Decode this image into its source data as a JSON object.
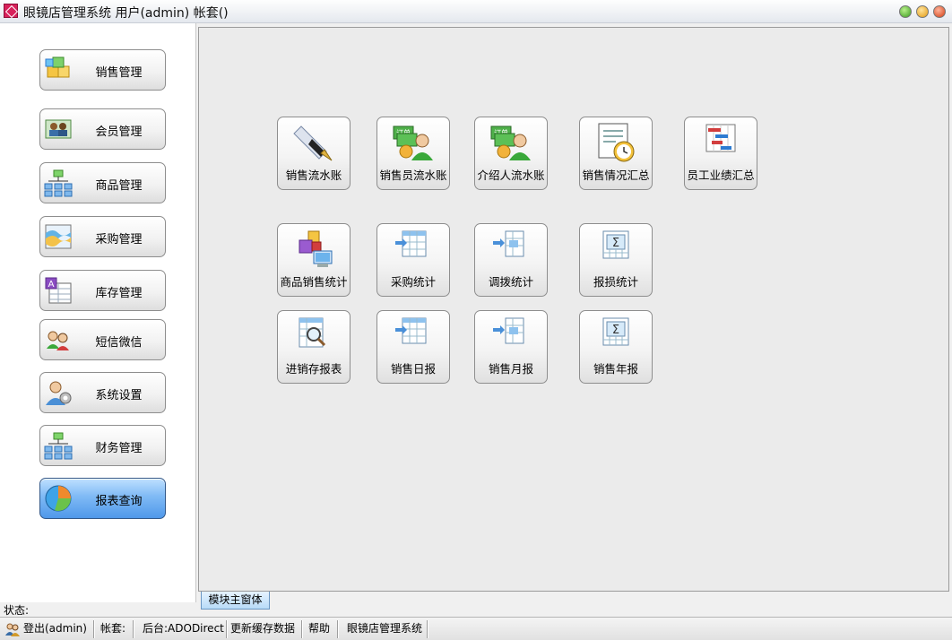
{
  "window": {
    "title": "眼镜店管理系统 用户(admin) 帐套()"
  },
  "sidebar": {
    "items": [
      {
        "label": "销售管理",
        "icon": "cubes-icon"
      },
      {
        "label": "会员管理",
        "icon": "members-icon"
      },
      {
        "label": "商品管理",
        "icon": "hierarchy-icon"
      },
      {
        "label": "采购管理",
        "icon": "wave-chart-icon"
      },
      {
        "label": "库存管理",
        "icon": "inventory-icon"
      },
      {
        "label": "短信微信",
        "icon": "people-chat-icon"
      },
      {
        "label": "系统设置",
        "icon": "user-gear-icon"
      },
      {
        "label": "财务管理",
        "icon": "hierarchy-icon"
      },
      {
        "label": "报表查询",
        "icon": "pie-chart-icon",
        "active": true
      }
    ]
  },
  "main": {
    "tiles": [
      {
        "label": "销售流水账",
        "icon": "fountain-pen-icon"
      },
      {
        "label": "销售员流水账",
        "icon": "order-user-icon"
      },
      {
        "label": "介绍人流水账",
        "icon": "order-user-icon"
      },
      {
        "label": "销售情况汇总",
        "icon": "report-clock-icon"
      },
      {
        "label": "员工业绩汇总",
        "icon": "gantt-icon"
      },
      {
        "label": "商品销售统计",
        "icon": "cubes-computer-icon"
      },
      {
        "label": "采购统计",
        "icon": "table-arrow-icon"
      },
      {
        "label": "调拨统计",
        "icon": "table-arrow-icon"
      },
      {
        "label": "报损统计",
        "icon": "table-sigma-icon"
      },
      {
        "label": "进销存报表",
        "icon": "table-search-icon"
      },
      {
        "label": "销售日报",
        "icon": "table-arrow-icon"
      },
      {
        "label": "销售月报",
        "icon": "table-arrow-icon"
      },
      {
        "label": "销售年报",
        "icon": "table-sigma-icon"
      }
    ]
  },
  "tab": {
    "label": "模块主窗体"
  },
  "status": {
    "label": "状态:"
  },
  "statusbar": {
    "login": "登出(admin)",
    "account": "帐套:",
    "backend": "后台:ADODirect",
    "refresh": "更新缓存数据",
    "help": "帮助",
    "app": "眼镜店管理系统"
  },
  "colors": {
    "active_button": "#6aaef0",
    "panel_bg": "#ebebeb",
    "accent_green": "#3aa83a",
    "accent_blue": "#2d7bd1"
  }
}
